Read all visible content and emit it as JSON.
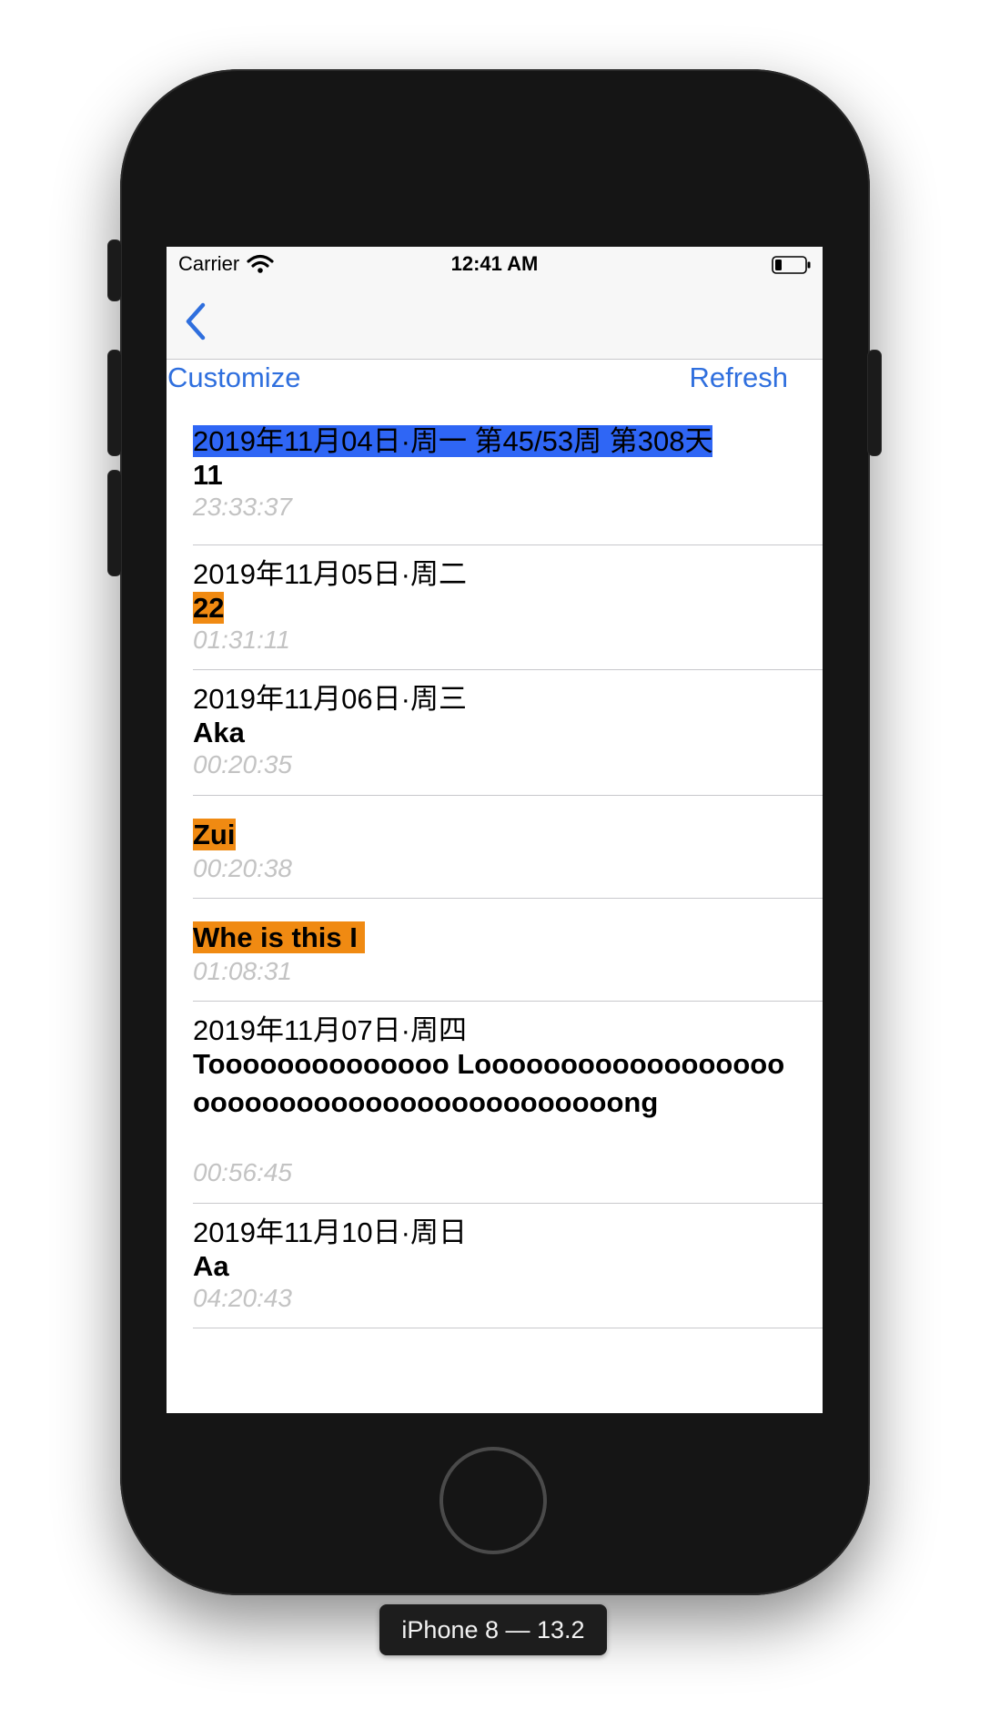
{
  "status_bar": {
    "carrier": "Carrier",
    "time": "12:41 AM",
    "wifi_icon": "wifi-icon",
    "battery_icon": "battery-icon"
  },
  "nav_bar": {
    "back_icon": "chevron-left-icon"
  },
  "toolbar": {
    "customize_label": "Customize",
    "refresh_label": "Refresh"
  },
  "list": {
    "items": [
      {
        "date": "2019年11月04日·周一 第45/53周 第308天",
        "title": "11",
        "time": "23:33:37",
        "date_highlight": "blue"
      },
      {
        "date": "2019年11月05日·周二",
        "title": "22",
        "time": "01:31:11",
        "title_highlight": "orange"
      },
      {
        "date": "2019年11月06日·周三",
        "title": "Aka",
        "time": "00:20:35"
      },
      {
        "date": "",
        "title": "Zui",
        "time": "00:20:38",
        "title_highlight": "orange"
      },
      {
        "date": "",
        "title": "Whe is this I ",
        "time": "01:08:31",
        "title_highlight": "orange"
      },
      {
        "date": "2019年11月07日·周四",
        "title": "Toooooooooooooo Looooooooooooooooooooooooooooooooooooooooooong",
        "time": "00:56:45"
      },
      {
        "date": "2019年11月10日·周日",
        "title": "Aa",
        "time": "04:20:43"
      }
    ]
  },
  "device": {
    "label": "iPhone 8 — 13.2"
  },
  "colors": {
    "accent": "#2f6fde",
    "highlight_blue": "#2f66f5",
    "highlight_orange": "#f08a12",
    "time_gray": "#c3c3c3"
  }
}
